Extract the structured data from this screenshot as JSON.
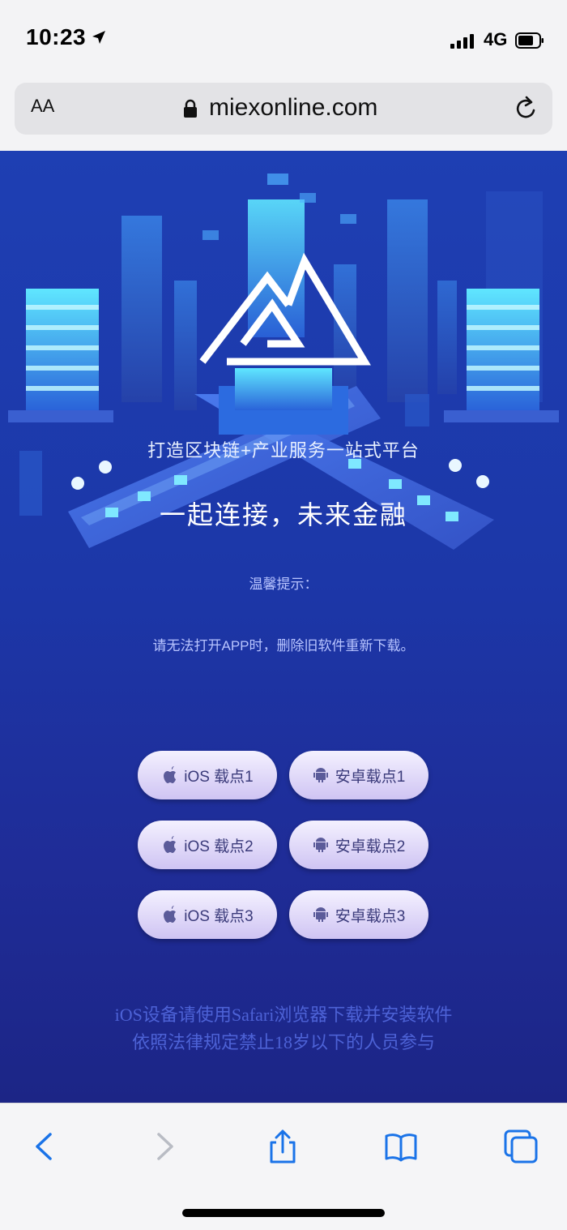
{
  "status_bar": {
    "time": "10:23",
    "network": "4G"
  },
  "browser": {
    "text_size_label": "AA",
    "url": "miexonline.com"
  },
  "page": {
    "slogan_primary": "打造区块链+产业服务一站式平台",
    "slogan_secondary": "一起连接，未来金融",
    "tip_title": "温馨提示：",
    "tip_text": "请无法打开APP时，删除旧软件重新下载。",
    "download_buttons": [
      {
        "ios_label": "iOS 载点1",
        "android_label": "安卓载点1"
      },
      {
        "ios_label": "iOS 载点2",
        "android_label": "安卓载点2"
      },
      {
        "ios_label": "iOS 载点3",
        "android_label": "安卓载点3"
      }
    ],
    "footnote_line1": "iOS设备请使用Safari浏览器下载并安装软件",
    "footnote_line2": "依照法律规定禁止18岁以下的人员参与"
  },
  "icons": {
    "location": "location-arrow-icon",
    "lock": "lock-icon",
    "reload": "reload-icon",
    "apple": "apple-icon",
    "android": "android-icon",
    "back": "back-chevron-icon",
    "forward": "forward-chevron-icon",
    "share": "share-icon",
    "bookmarks": "bookmarks-icon",
    "tabs": "tabs-icon"
  },
  "colors": {
    "accent": "#1a73e8",
    "page_top": "#1e3fb3",
    "page_bottom": "#1c2586",
    "button": "#d9d0f5"
  }
}
